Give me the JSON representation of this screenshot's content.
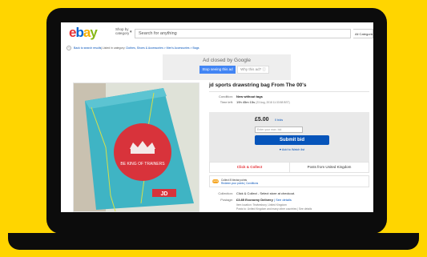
{
  "header": {
    "logo": {
      "e": "e",
      "b": "b",
      "a": "a",
      "y": "y"
    },
    "shop_by": "Shop by category",
    "shop_by_caret": "▾",
    "search_placeholder": "Search for anything",
    "all_categories": "All Categories"
  },
  "breadcrumb": {
    "back_glyph": "‹",
    "back": "Back to search results",
    "listed": "| Listed in category:",
    "path": "Clothes, Shoes & Accessories > Men's Accessories > Bags"
  },
  "ad": {
    "closed_by": "Ad closed by Google",
    "stop": "Stop seeing this ad",
    "why": "Why this ad? ⓘ"
  },
  "listing": {
    "title": "jd sports drawstring bag From The 00's",
    "condition_label": "Condition:",
    "condition_value": "New without tags",
    "time_left_label": "Time left:",
    "time_left_value": "19h 45m 15s",
    "time_left_detail": "(23 Aug, 2018  11:33:58 BST)",
    "price": "£5.00",
    "bids": "0 bids",
    "bid_placeholder": "Enter your max. bid",
    "submit_bid": "Submit bid",
    "watch": "♥  Add to Watch list",
    "click_collect": "Click & Collect",
    "posts_from": "Posts from United Kingdom",
    "nectar_logo": "nectar",
    "nectar_line1": "Collect 8 Nectar points",
    "nectar_line2": "Redeem your points | Conditions",
    "collection_label": "Collection:",
    "collection_value": "Click & Collect - Select store at checkout.",
    "postage_label": "Postage:",
    "postage_value": "£3.85 Economy Delivery",
    "postage_details": "| See details",
    "item_location": "Item location: Tewkesbury, United Kingdom",
    "posts_to": "Posts to: United Kingdom and many other countries | See details",
    "bag_brand_text": "JD",
    "bag_slogan": "BE KING OF TRAINERS"
  },
  "colors": {
    "background": "#FFD500",
    "bag": "#3fb4c4",
    "bag_circle": "#d8333b",
    "ebay_blue": "#0654ba",
    "click_collect_red": "#e53238"
  }
}
